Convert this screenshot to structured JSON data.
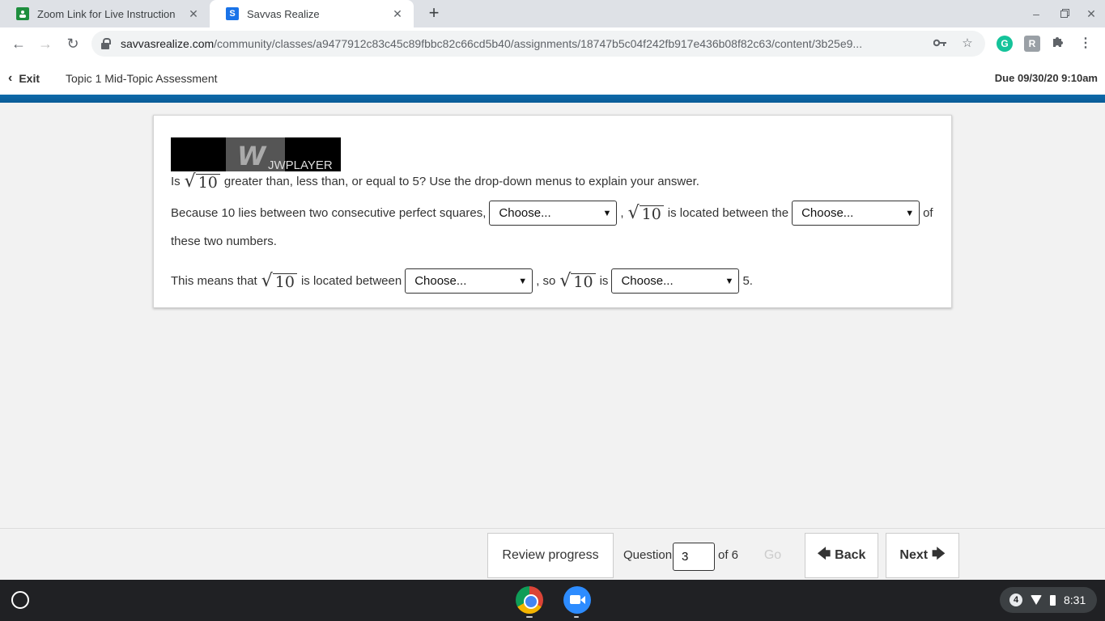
{
  "browser": {
    "tabs": [
      {
        "title": "Zoom Link for Live Instruction",
        "favicon_color": "#1e8e3e",
        "active": false
      },
      {
        "title": "Savvas Realize",
        "favicon_color": "#1a73e8",
        "favicon_letter": "S",
        "active": true
      }
    ],
    "new_tab": "+",
    "url_host": "savvasrealize.com",
    "url_path": "/community/classes/a9477912c83c45c89fbbc82c66cd5b40/assignments/18747b5c04f242fb917e436b08f82c63/content/3b25e9..."
  },
  "header": {
    "exit_label": "Exit",
    "title": "Topic 1 Mid-Topic Assessment",
    "due": "Due 09/30/20 9:10am",
    "accent_color": "#0e6aaa"
  },
  "player": {
    "brand": "JWPLAYER"
  },
  "question": {
    "radicand": "10",
    "line1_pre": "Is",
    "line1_post": "greater than, less than, or equal to 5? Use the drop-down menus to explain your answer.",
    "line2_a": "Because 10 lies between two consecutive perfect squares,",
    "line2_b": ",",
    "line2_c": "is located between the",
    "line2_d": "of",
    "line2_cont": "these two numbers.",
    "line3_a": "This means that",
    "line3_b": "is located between",
    "line3_c": ", so",
    "line3_d": "is",
    "line3_e": "5.",
    "dropdown_placeholder": "Choose..."
  },
  "footer": {
    "review_label": "Review progress",
    "question_label": "Question",
    "question_number": "3",
    "of_label": "of 6",
    "go_label": "Go",
    "back_label": "Back",
    "next_label": "Next"
  },
  "shelf": {
    "notification_count": "4",
    "time": "8:31"
  }
}
